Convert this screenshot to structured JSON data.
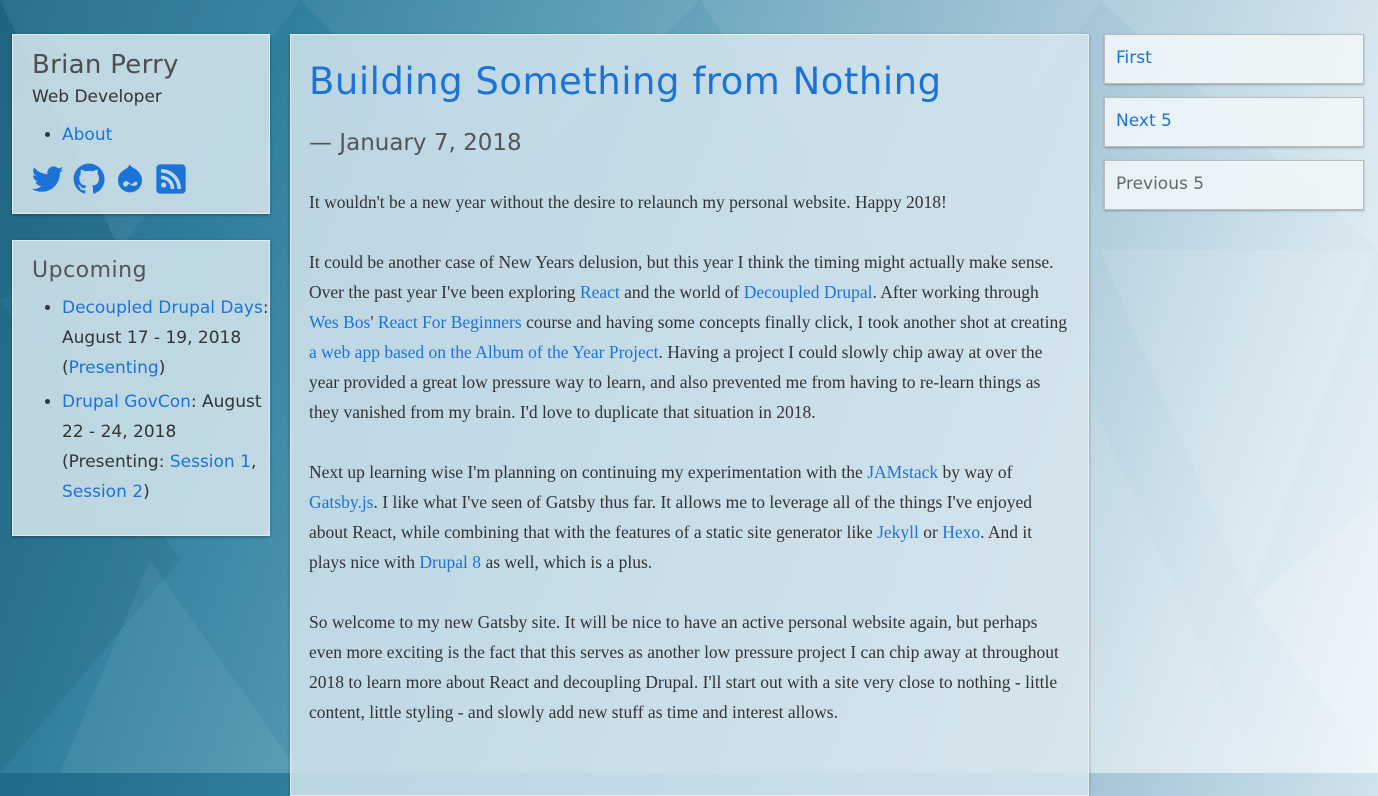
{
  "profile": {
    "name": "Brian Perry",
    "role": "Web Developer",
    "nav": [
      {
        "label": "About"
      }
    ],
    "social_icons": [
      "twitter-icon",
      "github-icon",
      "drupal-icon",
      "rss-icon"
    ]
  },
  "upcoming": {
    "title": "Upcoming",
    "events": [
      {
        "name": "Decoupled Drupal Days",
        "date": ": August 17 - 19, 2018 (",
        "link": "Presenting",
        "close": ")"
      },
      {
        "name": "Drupal GovCon",
        "date": ": August 22 - 24, 2018 (Presenting: ",
        "link1": "Session 1",
        "sep": ", ",
        "link2": "Session 2",
        "close": ")"
      }
    ]
  },
  "article": {
    "title": "Building Something from Nothing",
    "date": "— January 7, 2018",
    "p1": "It wouldn't be a new year without the desire to relaunch my personal website. Happy 2018!",
    "p2": {
      "t1": "It could be another case of New Years delusion, but this year I think the timing might actually make sense. Over the past year I've been exploring ",
      "l1": "React",
      "t2": " and the world of ",
      "l2": "Decoupled Drupal",
      "t3": ". After working through ",
      "l3": "Wes Bos",
      "t4": "' ",
      "l4": "React For Beginners",
      "t5": " course and having some concepts finally click, I took another shot at creating ",
      "l5": "a web app based on the Album of the Year Project",
      "t6": ". Having a project I could slowly chip away at over the year provided a great low pressure way to learn, and also prevented me from having to re-learn things as they vanished from my brain. I'd love to duplicate that situation in 2018."
    },
    "p3": {
      "t1": "Next up learning wise I'm planning on continuing my experimentation with the ",
      "l1": "JAMstack",
      "t2": " by way of ",
      "l2": "Gatsby.js",
      "t3": ". I like what I've seen of Gatsby thus far. It allows me to leverage all of the things I've enjoyed about React, while combining that with the features of a static site generator like ",
      "l3": "Jekyll",
      "t4": " or ",
      "l4": "Hexo",
      "t5": ". And it plays nice with ",
      "l5": "Drupal 8",
      "t6": " as well, which is a plus."
    },
    "p4": "So welcome to my new Gatsby site. It will be nice to have an active personal website again, but perhaps even more exciting is the fact that this serves as another low pressure project I can chip away at throughout 2018 to learn more about React and decoupling Drupal. I'll start out with a site very close to nothing - little content, little styling - and slowly add new stuff as time and interest allows."
  },
  "pager": {
    "first": "First",
    "next": "Next 5",
    "previous": "Previous 5"
  },
  "colors": {
    "link": "#1b73d8",
    "text": "#333333",
    "panel": "#d6e6ee"
  }
}
